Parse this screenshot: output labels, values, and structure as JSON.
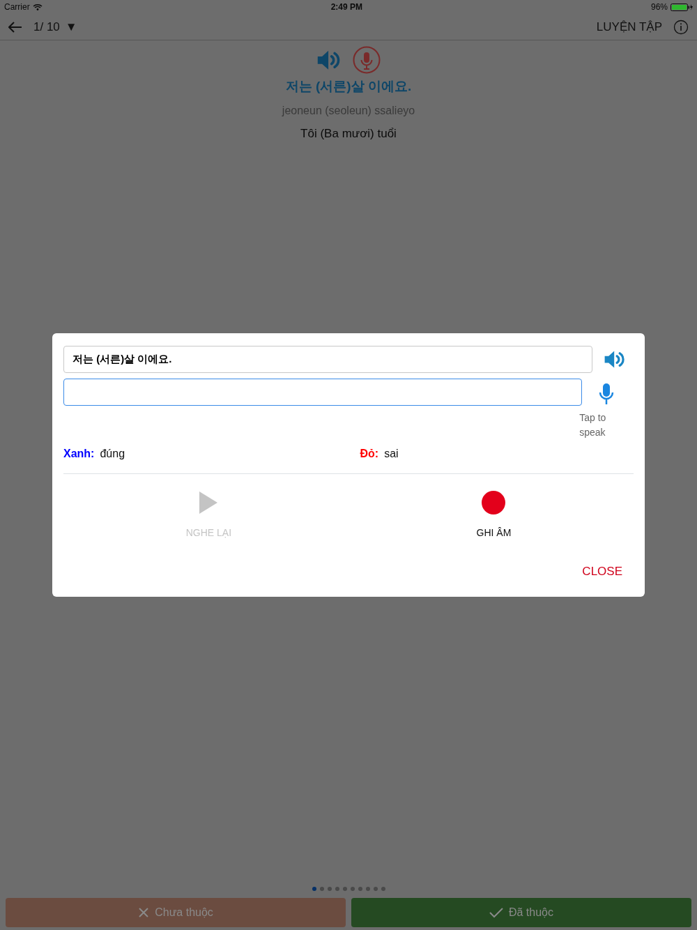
{
  "status_bar": {
    "carrier": "Carrier",
    "time": "2:49 PM",
    "battery": "96%"
  },
  "nav": {
    "counter": "1/ 10",
    "dropdown": "▼",
    "action": "LUYỆN TẬP"
  },
  "card": {
    "korean": "저는 (서른)살 이에요.",
    "romanization": "jeoneun (seoleun) ssalieyo",
    "translation": "Tôi (Ba mươi) tuổi"
  },
  "pager": [
    {
      "selected": true
    },
    {
      "selected": false
    },
    {
      "selected": false
    },
    {
      "selected": false
    },
    {
      "selected": false
    },
    {
      "selected": false
    },
    {
      "selected": false
    },
    {
      "selected": false
    },
    {
      "selected": false
    },
    {
      "selected": false
    }
  ],
  "buttons": [
    {
      "label": "Chưa thuộc",
      "kind": "wrong"
    },
    {
      "label": "Đã thuộc",
      "kind": "right"
    }
  ],
  "dialog": {
    "sentence": "저는 (서른)살 이에요.",
    "answer_focused": true,
    "mic_caption": "Tap to speak",
    "legend": [
      {
        "label": "Xanh:",
        "meaning": "đúng",
        "color": "#0000ff"
      },
      {
        "label": "Đỏ:",
        "meaning": "sai",
        "color": "#ff0000"
      }
    ],
    "controls": [
      {
        "label": "NGHE LẠI",
        "kind": "play",
        "disabled": true
      },
      {
        "label": "GHI ÂM",
        "kind": "record",
        "disabled": false
      }
    ],
    "close": "CLOSE"
  }
}
